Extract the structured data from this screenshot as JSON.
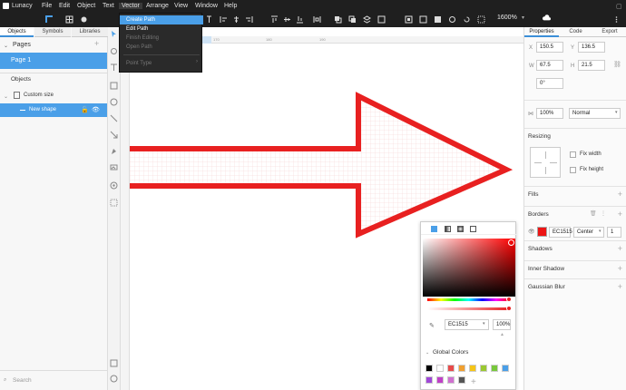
{
  "app": {
    "title": "Lunacy"
  },
  "menu": [
    "File",
    "Edit",
    "Object",
    "Text",
    "Vector",
    "Arrange",
    "View",
    "Window",
    "Help"
  ],
  "zoom": "1600%",
  "vector_menu": {
    "items": [
      {
        "label": "Create Path",
        "state": "highlighted"
      },
      {
        "label": "Edit Path",
        "state": "enabled"
      },
      {
        "label": "Finish Editing",
        "state": "disabled"
      },
      {
        "label": "Open Path",
        "state": "disabled"
      },
      {
        "label": "Point Type",
        "state": "disabled"
      }
    ]
  },
  "left_panel": {
    "tabs": [
      "Objects",
      "Symbols",
      "Libraries"
    ],
    "pages_title": "Pages",
    "page1": "Page 1",
    "objects_title": "Objects",
    "group": "Custom size",
    "layer": "New shape",
    "search_placeholder": "Search"
  },
  "ruler": {
    "marks": [
      "170",
      "180",
      "190"
    ]
  },
  "right_panel": {
    "tabs": [
      "Properties",
      "Code",
      "Export"
    ],
    "x_label": "X",
    "x": "150.5",
    "y_label": "Y",
    "y": "136.5",
    "w_label": "W",
    "w": "67.5",
    "h_label": "H",
    "h": "21.5",
    "rotation": "0°",
    "opacity": "100%",
    "blend": "Normal",
    "resizing": "Resizing",
    "fix_width": "Fix width",
    "fix_height": "Fix height",
    "fills": "Fills",
    "borders": "Borders",
    "border_hex": "EC1515",
    "border_position": "Center",
    "border_width": "1",
    "shadows": "Shadows",
    "inner_shadow": "Inner Shadow",
    "gaussian_blur": "Gaussian Blur"
  },
  "picker": {
    "hex": "EC1515",
    "opacity": "100%",
    "global_colors": "Global Colors",
    "swatches": [
      "#000000",
      "#ffffff",
      "#e84a4a",
      "#f0a030",
      "#f5c518",
      "#9ac832",
      "#78c83c",
      "#4a9fe8",
      "#a048d8",
      "#c040c8",
      "#d070d0",
      "#555555"
    ]
  },
  "colors": {
    "accent": "#4a9fe8",
    "border": "#EC1515"
  }
}
